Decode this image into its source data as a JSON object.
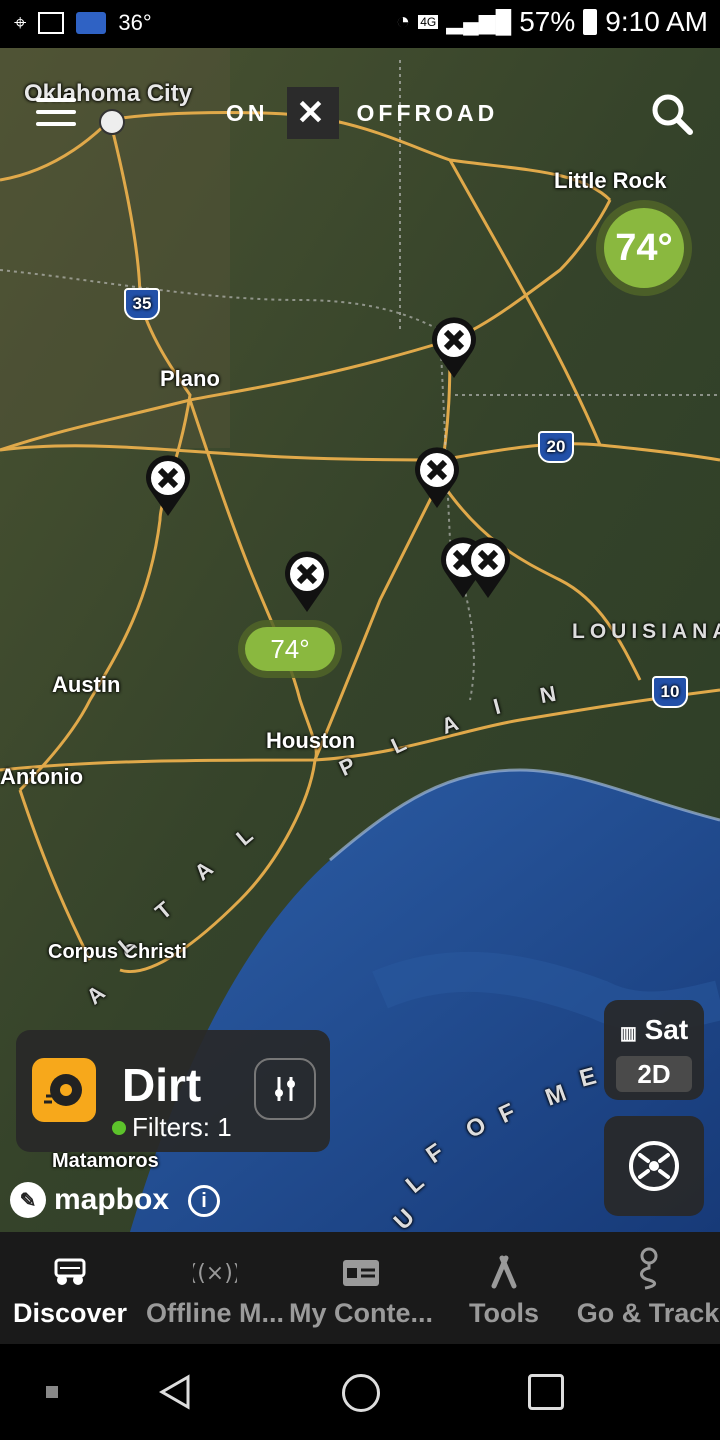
{
  "status": {
    "temperature": "36°",
    "network": "4G",
    "battery": "57%",
    "time": "9:10 AM"
  },
  "header": {
    "brand_left": "ON",
    "brand_mark": "✕",
    "brand_right": "OFFROAD"
  },
  "map": {
    "places": {
      "oklahoma_city": "Oklahoma City",
      "little_rock": "Little Rock",
      "plano": "Plano",
      "austin": "Austin",
      "houston": "Houston",
      "san_antonio": "Antonio",
      "corpus_christi": "Corpus Christi",
      "matamoros": "Matamoros",
      "louisiana": "LOUISIANA"
    },
    "highways": {
      "i35": "35",
      "i20": "20",
      "i10": "10"
    },
    "plain_letters": [
      "A",
      "L",
      "T",
      "A",
      "L",
      "P",
      "L",
      "A",
      "I",
      "N"
    ],
    "gulf_letters": [
      "U",
      "L",
      "F",
      "O",
      "F",
      "M",
      "E"
    ],
    "weather_big": "74°",
    "weather_small": "74°"
  },
  "trail_card": {
    "title": "Dirt",
    "filters": "Filters: 1"
  },
  "map_controls": {
    "layer": "Sat",
    "view": "2D"
  },
  "attribution": {
    "logo": "mapbox",
    "info": "i"
  },
  "tabs": [
    {
      "label": "Discover",
      "icon": "jeep-icon",
      "active": true
    },
    {
      "label": "Offline M...",
      "icon": "offline-signal-icon",
      "active": false
    },
    {
      "label": "My Conte...",
      "icon": "content-card-icon",
      "active": false
    },
    {
      "label": "Tools",
      "icon": "tools-icon",
      "active": false
    },
    {
      "label": "Go & Track",
      "icon": "route-pin-icon",
      "active": false
    }
  ],
  "colors": {
    "accent_orange": "#f7a81b",
    "weather_green": "#8ab83f",
    "filter_dot": "#5cc22b",
    "ocean": "#1f4a8a",
    "land": "#3e4a2c",
    "roads": "#e0a94a"
  }
}
